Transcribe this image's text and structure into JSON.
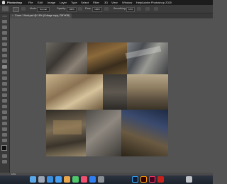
{
  "menubar": {
    "app": "Photoshop",
    "items": [
      "File",
      "Edit",
      "Image",
      "Layer",
      "Type",
      "Select",
      "Filter",
      "3D",
      "View",
      "Window",
      "Help"
    ],
    "window_title": "Adobe Photoshop 2020"
  },
  "options_bar": {
    "mode_label": "Mode:",
    "mode_value": "Normal",
    "opacity_label": "Opacity:",
    "opacity_value": "100%",
    "flow_label": "Flow:",
    "flow_value": "100%",
    "smoothing_label": "Smoothing:",
    "smoothing_value": "10%"
  },
  "document_tab": {
    "title": "Cover 1 final.psd @ 16% (Collage copy, CMYK/8)",
    "close_glyph": "×"
  },
  "statusbar": {
    "zoom": "16%"
  },
  "dock_apps": [
    "finder-icon",
    "launchpad-icon",
    "safari-icon",
    "mail-icon",
    "photos-icon",
    "messages-icon",
    "music-icon",
    "app-store-icon",
    "preferences-icon",
    "photoshop-icon",
    "illustrator-icon",
    "indesign-icon",
    "acrobat-icon",
    "trash-icon"
  ],
  "colors": {
    "menubar": "#1c1c1c",
    "optionsbar": "#3c3c3c",
    "workspace": "#535353",
    "tab_active": "#4a4a4a"
  }
}
